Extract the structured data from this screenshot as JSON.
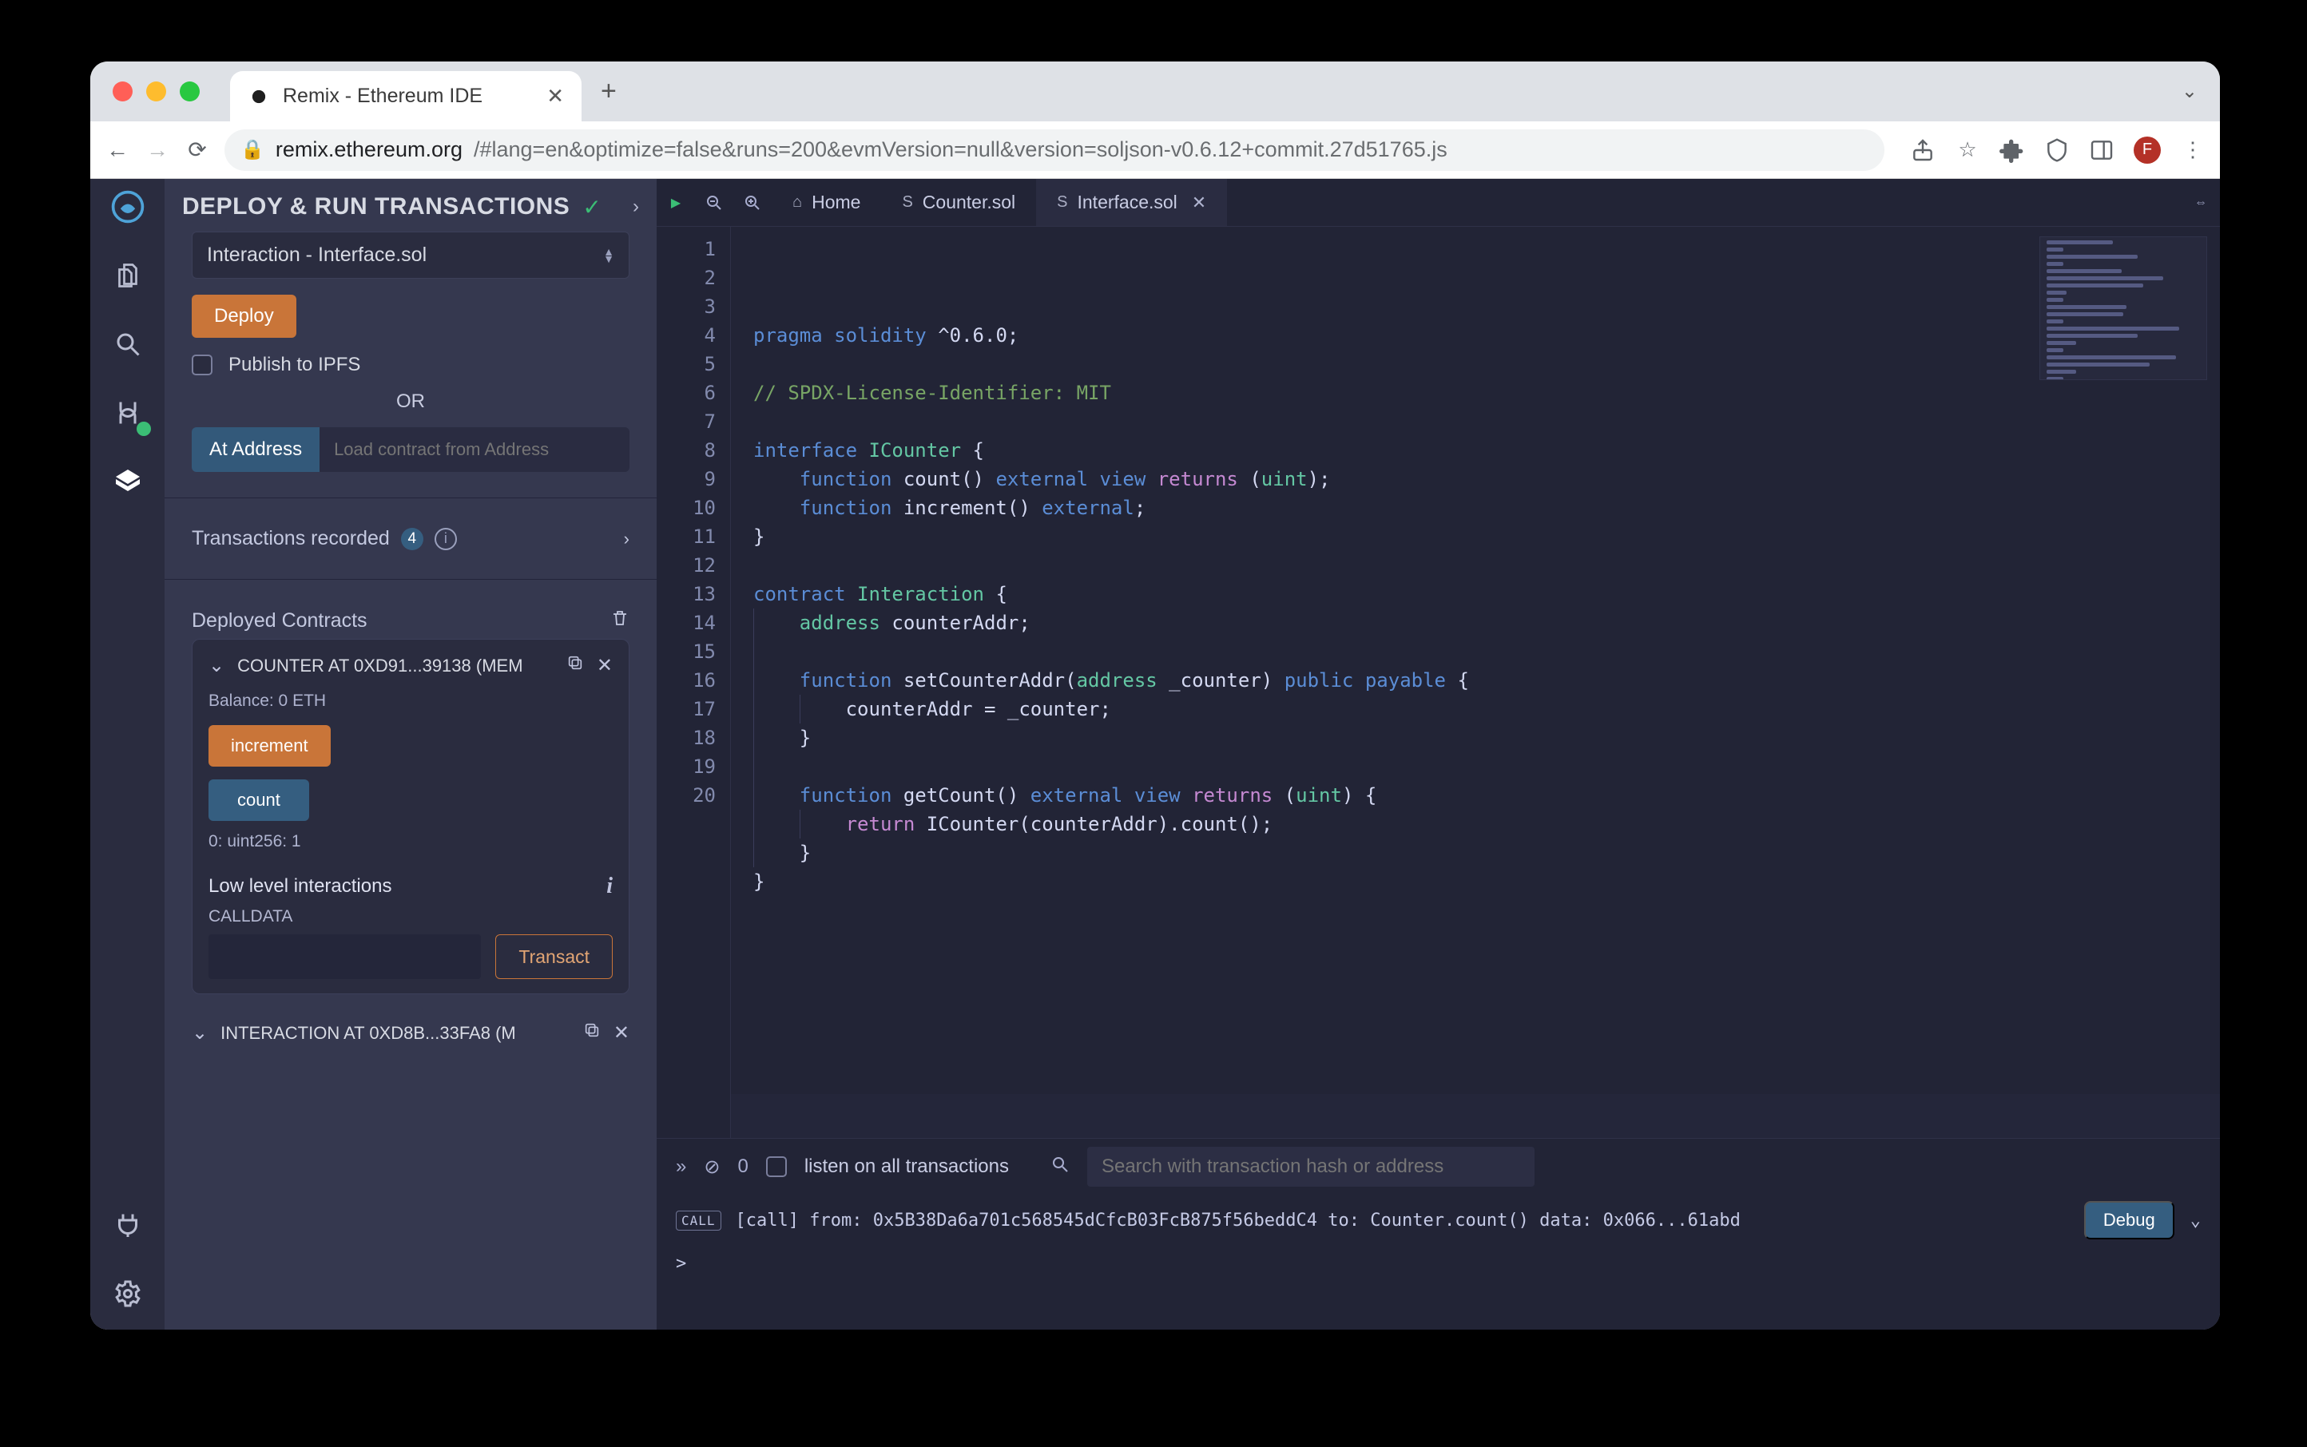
{
  "browser": {
    "tab_title": "Remix - Ethereum IDE",
    "url_host": "remix.ethereum.org",
    "url_path": "/#lang=en&optimize=false&runs=200&evmVersion=null&version=soljson-v0.6.12+commit.27d51765.js",
    "avatar_letter": "F"
  },
  "panel": {
    "title": "DEPLOY & RUN TRANSACTIONS",
    "contract_select": "Interaction - Interface.sol",
    "deploy_btn": "Deploy",
    "ipfs_label": "Publish to IPFS",
    "or": "OR",
    "at_address_btn": "At Address",
    "at_address_placeholder": "Load contract from Address",
    "tx_section": "Transactions recorded",
    "tx_count": "4",
    "dc_title": "Deployed Contracts",
    "c1_name": "COUNTER AT 0XD91...39138 (MEM",
    "c1_balance": "Balance: 0 ETH",
    "btn_increment": "increment",
    "btn_count": "count",
    "count_result": "0: uint256: 1",
    "low_level": "Low level interactions",
    "calldata_label": "CALLDATA",
    "transact_btn": "Transact",
    "c2_name": "INTERACTION AT 0XD8B...33FA8 (M"
  },
  "editor": {
    "tabs": {
      "home": "Home",
      "t1": "Counter.sol",
      "t2": "Interface.sol"
    },
    "lines": [
      {
        "n": "1",
        "h": "<span class='tk-k'>pragma</span> <span class='tk-k'>solidity</span> ^0.6.0;"
      },
      {
        "n": "2",
        "h": ""
      },
      {
        "n": "3",
        "h": "<span class='tk-c'>// SPDX-License-Identifier: MIT</span>"
      },
      {
        "n": "4",
        "h": ""
      },
      {
        "n": "5",
        "h": "<span class='tk-k'>interface</span> <span class='tk-t'>ICounter</span> {"
      },
      {
        "n": "6",
        "h": "    <span class='tk-k'>function</span> count() <span class='tk-k'>external</span> <span class='tk-k'>view</span> <span class='tk-p'>returns</span> (<span class='tk-t'>uint</span>);"
      },
      {
        "n": "7",
        "h": "    <span class='tk-k'>function</span> increment() <span class='tk-k'>external</span>;"
      },
      {
        "n": "8",
        "h": "}"
      },
      {
        "n": "9",
        "h": ""
      },
      {
        "n": "10",
        "h": "<span class='tk-k'>contract</span> <span class='tk-t'>Interaction</span> {"
      },
      {
        "n": "11",
        "h": "<span class='guide'></span>    <span class='tk-t'>address</span> counterAddr;"
      },
      {
        "n": "12",
        "h": "<span class='guide'></span>"
      },
      {
        "n": "13",
        "h": "<span class='guide'></span>    <span class='tk-k'>function</span> setCounterAddr(<span class='tk-t'>address</span> _counter) <span class='tk-k'>public</span> <span class='tk-k'>payable</span> {"
      },
      {
        "n": "14",
        "h": "<span class='guide'></span>    <span class='guide'></span>    counterAddr = _counter;"
      },
      {
        "n": "15",
        "h": "<span class='guide'></span>    }"
      },
      {
        "n": "16",
        "h": "<span class='guide'></span>"
      },
      {
        "n": "17",
        "h": "<span class='guide'></span>    <span class='tk-k'>function</span> getCount() <span class='tk-k'>external</span> <span class='tk-k'>view</span> <span class='tk-p'>returns</span> (<span class='tk-t'>uint</span>) {"
      },
      {
        "n": "18",
        "h": "<span class='guide'></span>    <span class='guide'></span>    <span class='tk-p'>return</span> ICounter(counterAddr).count();"
      },
      {
        "n": "19",
        "h": "<span class='guide'></span>    }"
      },
      {
        "n": "20",
        "h": "}"
      }
    ]
  },
  "terminal": {
    "zero": "0",
    "listen": "listen on all transactions",
    "search_placeholder": "Search with transaction hash or address",
    "call_tag": "CALL",
    "log": "[call]  from:  0x5B38Da6a701c568545dCfcB03FcB875f56beddC4  to:  Counter.count()  data:  0x066...61abd",
    "debug": "Debug",
    "prompt": ">"
  }
}
